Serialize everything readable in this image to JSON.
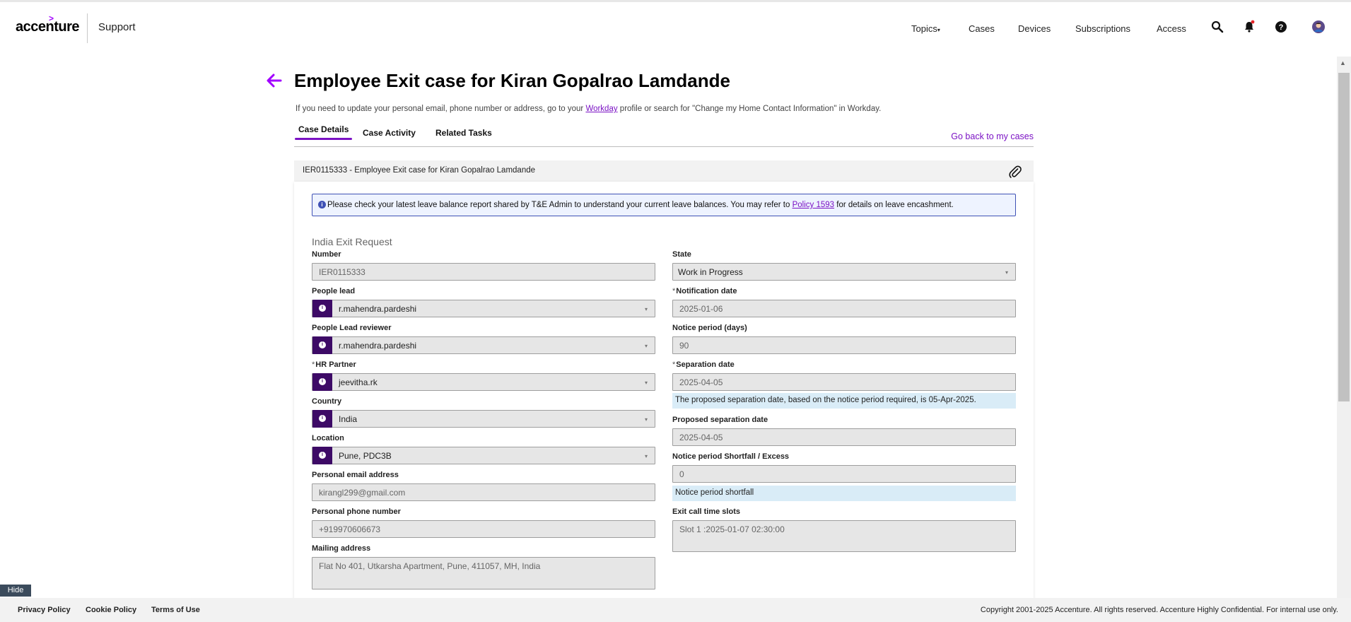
{
  "brand": {
    "logo_text": "accenture",
    "logo_caret": ">",
    "section": "Support"
  },
  "nav": {
    "items": [
      {
        "label": "Topics"
      },
      {
        "label": "Cases"
      },
      {
        "label": "Devices"
      },
      {
        "label": "Subscriptions"
      },
      {
        "label": "Access"
      }
    ],
    "topics_caret": "▾",
    "icons": [
      "search-icon",
      "notification-bell-icon",
      "help-icon",
      "user-avatar"
    ]
  },
  "page": {
    "title": "Employee Exit case for Kiran Gopalrao Lamdande",
    "hint_before": "If you need to update your personal email, phone number or address, go to your ",
    "hint_link": "Workday",
    "hint_after": " profile or search for \"Change my Home Contact Information\" in Workday."
  },
  "tabs": [
    {
      "label": "Case Details",
      "active": true
    },
    {
      "label": "Case Activity",
      "active": false
    },
    {
      "label": "Related Tasks",
      "active": false
    }
  ],
  "back_to_cases": "Go back to my cases",
  "case_bar": {
    "text": "IER0115333 - Employee Exit case for Kiran Gopalrao Lamdande"
  },
  "notice": {
    "icon": "i",
    "before": "Please check your latest leave balance report shared by T&E Admin to understand your current leave balances. You may refer to ",
    "link": "Policy 1593",
    "after": " for details on leave encashment."
  },
  "form": {
    "section_title": "India Exit Request",
    "left": {
      "number": {
        "label": "Number",
        "value": "IER0115333"
      },
      "people_lead": {
        "label": "People lead",
        "value": "r.mahendra.pardeshi"
      },
      "people_lead_reviewer": {
        "label": "People Lead reviewer",
        "value": "r.mahendra.pardeshi"
      },
      "hr_partner": {
        "label": "HR Partner",
        "value": "jeevitha.rk"
      },
      "country": {
        "label": "Country",
        "value": "India"
      },
      "location": {
        "label": "Location",
        "value": "Pune, PDC3B"
      },
      "personal_email": {
        "label": "Personal email address",
        "value": "kirangl299@gmail.com"
      },
      "personal_phone": {
        "label": "Personal phone number",
        "value": "+919970606673"
      },
      "mailing_address": {
        "label": "Mailing address",
        "value": "Flat No 401, Utkarsha Apartment, Pune, 411057, MH, India"
      }
    },
    "right": {
      "state": {
        "label": "State",
        "value": "Work in Progress"
      },
      "notification_date": {
        "label": "Notification date",
        "value": "2025-01-06"
      },
      "notice_period_days": {
        "label": "Notice period (days)",
        "value": "90"
      },
      "separation_date": {
        "label": "Separation date",
        "value": "2025-04-05",
        "info": "The proposed separation date, based on the notice period required, is 05-Apr-2025."
      },
      "proposed_separation_date": {
        "label": "Proposed separation date",
        "value": "2025-04-05"
      },
      "notice_shortfall": {
        "label": "Notice period Shortfall / Excess",
        "value": "0",
        "info": "Notice period shortfall"
      },
      "exit_call_slots": {
        "label": "Exit call time slots",
        "value": "Slot 1 :2025-01-07 02:30:00"
      }
    },
    "required_mark": "*",
    "reference_icon": "i",
    "select_caret": "▾"
  },
  "hide_button": "Hide",
  "footer": {
    "links": [
      "Privacy Policy",
      "Cookie Policy",
      "Terms of Use"
    ],
    "copyright": "Copyright 2001-2025 Accenture. All rights reserved. Accenture Highly Confidential. For internal use only."
  },
  "scrollbar": {
    "up_arrow": "▲"
  },
  "colors": {
    "brand_purple": "#a100ff",
    "link_purple": "#7b12c4",
    "reference_button": "#3d0a66",
    "notice_border": "#3f51b5",
    "info_bar": "#d9ecf7"
  }
}
